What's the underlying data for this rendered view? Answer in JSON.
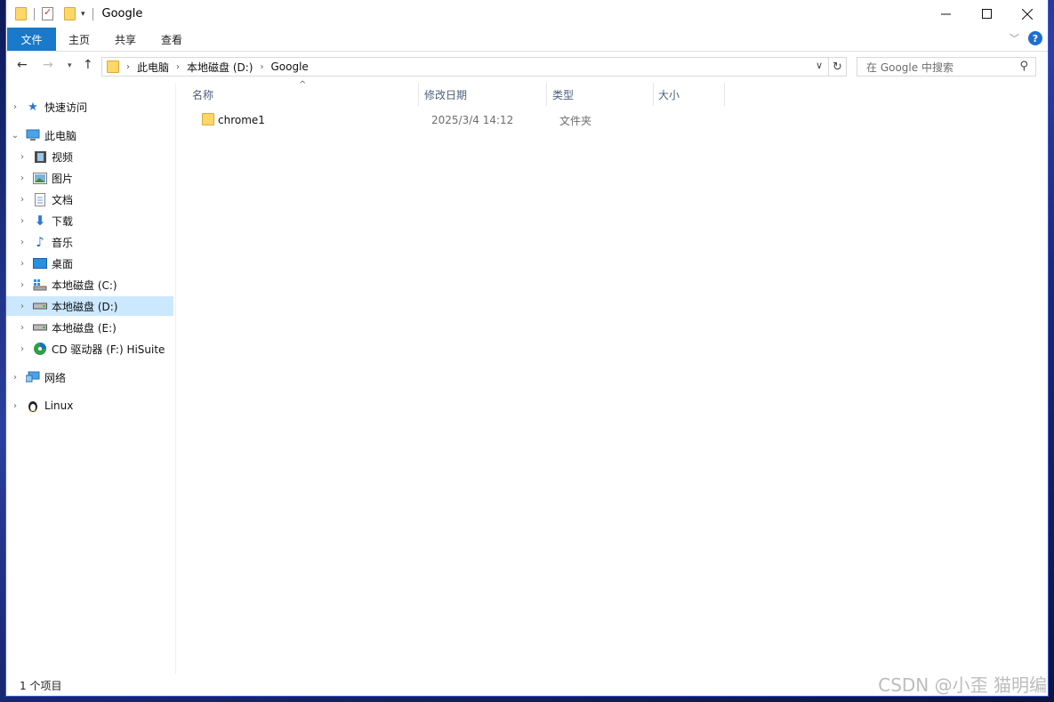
{
  "window": {
    "title": "Google"
  },
  "ribbon": {
    "tabs": [
      "文件",
      "主页",
      "共享",
      "查看"
    ]
  },
  "address": {
    "crumbs": [
      "此电脑",
      "本地磁盘 (D:)",
      "Google"
    ],
    "search_placeholder": "在 Google 中搜索"
  },
  "nav": {
    "quick_access": "快速访问",
    "this_pc": "此电脑",
    "videos": "视频",
    "pictures": "图片",
    "documents": "文档",
    "downloads": "下载",
    "music": "音乐",
    "desktop": "桌面",
    "drive_c": "本地磁盘 (C:)",
    "drive_d": "本地磁盘 (D:)",
    "drive_e": "本地磁盘 (E:)",
    "drive_f": "CD 驱动器 (F:) HiSuite",
    "network": "网络",
    "linux": "Linux"
  },
  "columns": {
    "name": "名称",
    "modified": "修改日期",
    "type": "类型",
    "size": "大小"
  },
  "files": [
    {
      "name": "chrome1",
      "modified": "2025/3/4 14:12",
      "type": "文件夹",
      "size": ""
    }
  ],
  "status": {
    "count": "1 个项目"
  },
  "watermark": "CSDN @小歪 猫明编",
  "icons": {
    "qat": [
      "folder-icon",
      "properties-icon",
      "new-folder-icon"
    ],
    "nav": [
      "star-icon",
      "computer-icon",
      "film-icon",
      "picture-icon",
      "document-icon",
      "download-arrow-icon",
      "music-note-icon",
      "desktop-icon",
      "drive-icon",
      "cd-drive-icon",
      "network-icon",
      "penguin-icon"
    ]
  },
  "colors": {
    "accent": "#1979ca",
    "selection": "#cce8ff",
    "folder": "#ffd768"
  }
}
